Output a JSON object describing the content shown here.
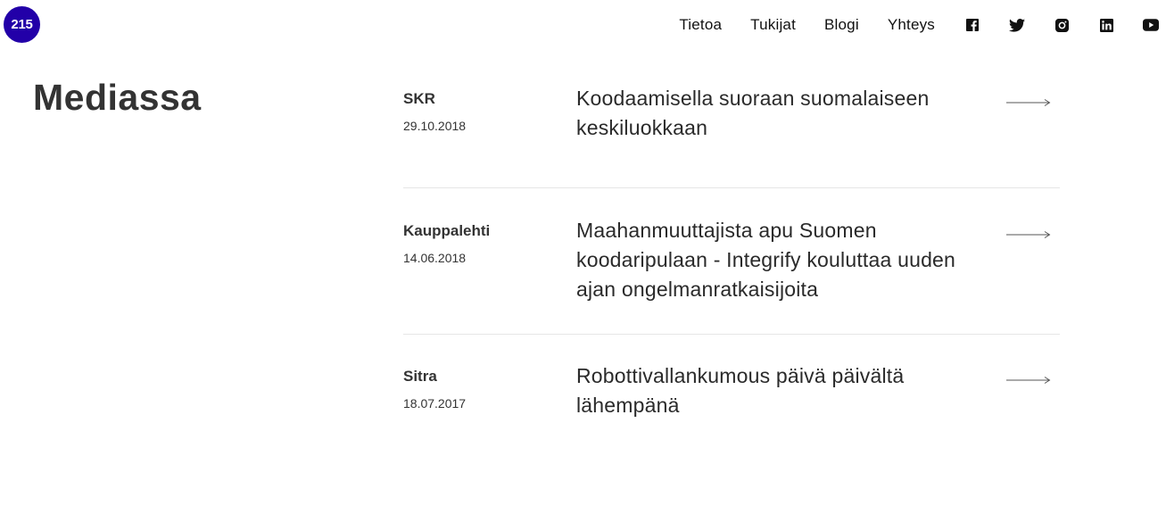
{
  "logo": {
    "text": "215"
  },
  "nav": {
    "links": [
      {
        "label": "Tietoa"
      },
      {
        "label": "Tukijat"
      },
      {
        "label": "Blogi"
      },
      {
        "label": "Yhteys"
      }
    ],
    "social": [
      "facebook-icon",
      "twitter-icon",
      "instagram-icon",
      "linkedin-icon",
      "youtube-icon"
    ]
  },
  "page": {
    "title": "Mediassa"
  },
  "articles": [
    {
      "source": "SKR",
      "date": "29.10.2018",
      "headline": "Koodaamisella suoraan suomalaiseen keskiluokkaan"
    },
    {
      "source": "Kauppalehti",
      "date": "14.06.2018",
      "headline": "Maahanmuuttajista apu Suomen koodaripulaan - Integrify kouluttaa uuden ajan ongelmanratkaisijoita"
    },
    {
      "source": "Sitra",
      "date": "18.07.2017",
      "headline": "Robottivallankumous päivä päivältä lähempänä"
    }
  ],
  "colors": {
    "brand": "#2200a8",
    "text": "#333333",
    "divider": "#e6e6e6"
  }
}
